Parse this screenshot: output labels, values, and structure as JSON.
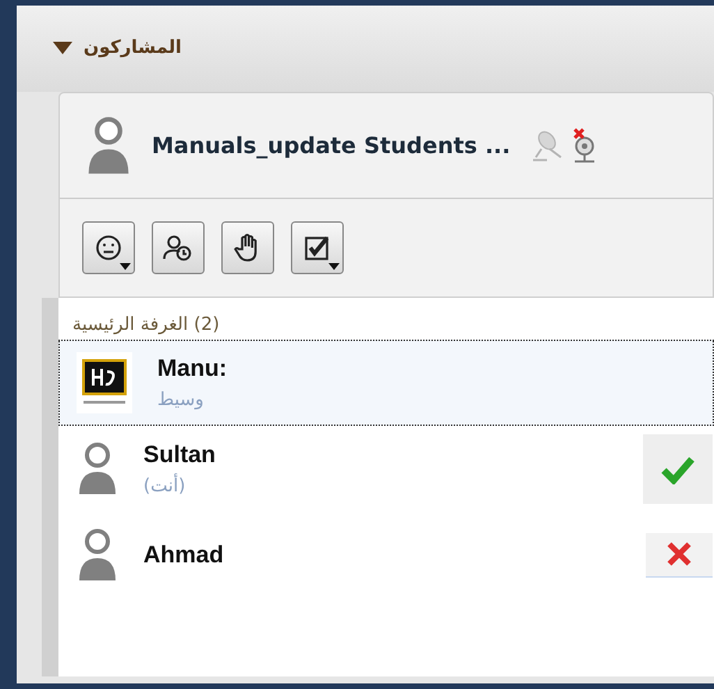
{
  "panel": {
    "title": "المشاركون",
    "expanded": true
  },
  "me": {
    "name": "Manuals_update Students ...",
    "mic_muted": true,
    "camera_off": true
  },
  "toolbar": [
    {
      "kind": "emotion",
      "menu": true
    },
    {
      "kind": "away",
      "menu": false
    },
    {
      "kind": "hand",
      "menu": false
    },
    {
      "kind": "poll",
      "menu": true
    }
  ],
  "room": {
    "label": "(2) الغرفة الرئيسية"
  },
  "participants": [
    {
      "name": "Manu:",
      "role": "وسيط",
      "kind": "logo",
      "selected": true
    },
    {
      "name": "Sultan",
      "role": "(أنت)",
      "kind": "person",
      "selected": false,
      "approved": true
    },
    {
      "name": "Ahmad",
      "kind": "person",
      "selected": false,
      "approved": false
    }
  ]
}
